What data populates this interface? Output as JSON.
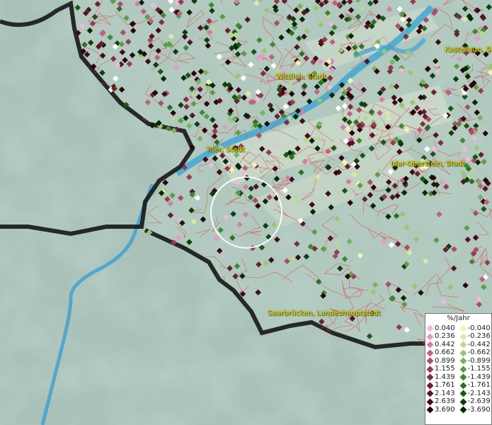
{
  "map": {
    "cities": [
      {
        "id": "wittlich",
        "name": "Wittlich, Stadt"
      },
      {
        "id": "kastellaun",
        "name": "Kastellaun, St"
      },
      {
        "id": "trier",
        "name": "Trier, Stadt"
      },
      {
        "id": "idar",
        "name": "Idar-Oberstein, Stadt"
      },
      {
        "id": "saarbruecken",
        "name": "Saarbrücken, Landeshauptstadt"
      }
    ]
  },
  "legend": {
    "title": "%/Jahr",
    "positive": [
      {
        "value": "0.040",
        "color": "#f2b8dc"
      },
      {
        "value": "0.236",
        "color": "#e79ac3"
      },
      {
        "value": "0.442",
        "color": "#d87ca6"
      },
      {
        "value": "0.662",
        "color": "#c2607f"
      },
      {
        "value": "0.899",
        "color": "#ad4c68"
      },
      {
        "value": "1.155",
        "color": "#983a52"
      },
      {
        "value": "1.439",
        "color": "#832b40"
      },
      {
        "value": "1.761",
        "color": "#6d1e30"
      },
      {
        "value": "2.143",
        "color": "#571322"
      },
      {
        "value": "2.639",
        "color": "#420a17"
      },
      {
        "value": "3.690",
        "color": "#2a040c"
      }
    ],
    "negative": [
      {
        "value": "-0.040",
        "color": "#f1f4b0"
      },
      {
        "value": "-0.236",
        "color": "#d8eba2"
      },
      {
        "value": "-0.442",
        "color": "#b9da8c"
      },
      {
        "value": "-0.662",
        "color": "#98c772"
      },
      {
        "value": "-0.899",
        "color": "#79b35c"
      },
      {
        "value": "-1.155",
        "color": "#5c9d45"
      },
      {
        "value": "-1.439",
        "color": "#438733"
      },
      {
        "value": "-1.761",
        "color": "#2d7023"
      },
      {
        "value": "-2.143",
        "color": "#1b5816"
      },
      {
        "value": "-2.639",
        "color": "#0e400c"
      },
      {
        "value": "-3.690",
        "color": "#052805"
      }
    ]
  }
}
